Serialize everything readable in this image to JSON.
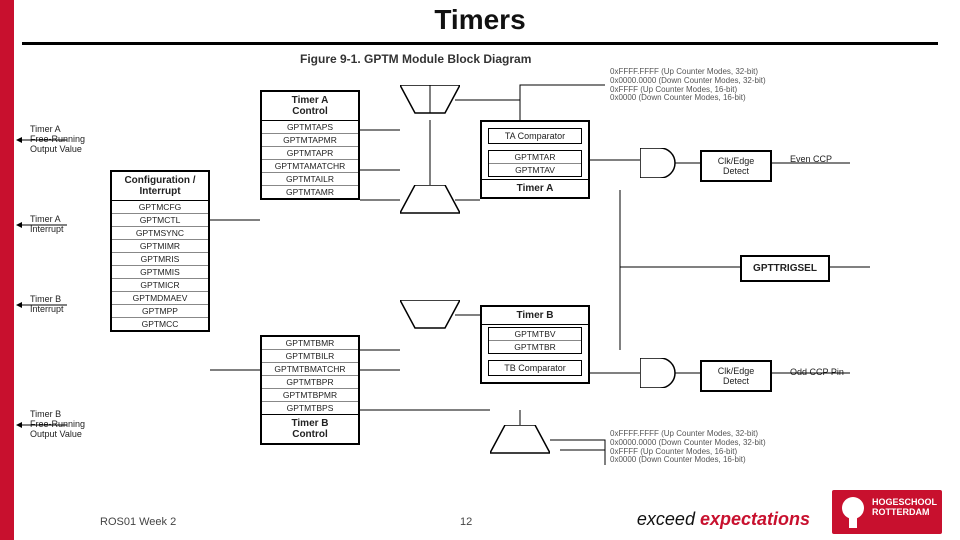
{
  "title": "Timers",
  "figure_caption": "Figure 9-1. GPTM Module Block Diagram",
  "footer": {
    "course": "ROS01 Week 2",
    "page": "12"
  },
  "tagline": {
    "a": "exceed ",
    "b": "expectations"
  },
  "logo_text": "HOGESCHOOL\nROTTERDAM",
  "labels": {
    "ta_free": "Timer A\nFree-Running\nOutput Value",
    "ta_int": "Timer A\nInterrupt",
    "tb_int": "Timer B\nInterrupt",
    "tb_free": "Timer B\nFree-Running\nOutput Value",
    "even_ccp": "Even CCP",
    "odd_ccp": "Odd CCP Pin",
    "clk_edge": "Clk/Edge\nDetect",
    "gpttrigsel": "GPTTRIGSEL",
    "modes_up32": "0xFFFF.FFFF  (Up Counter Modes, 32-bit)",
    "modes_dn32": "0x0000.0000  (Down Counter Modes, 32-bit)",
    "modes_up16": "0xFFFF        (Up Counter Modes, 16-bit)",
    "modes_dn16": "0x0000        (Down Counter Modes, 16-bit)"
  },
  "blocks": {
    "config": {
      "title": "Configuration /\nInterrupt",
      "regs": [
        "GPTMCFG",
        "GPTMCTL",
        "GPTMSYNC",
        "GPTMIMR",
        "GPTMRIS",
        "GPTMMIS",
        "GPTMICR",
        "GPTMDMAEV",
        "GPTMPP",
        "GPTMCC"
      ]
    },
    "ta_ctrl": {
      "title": "Timer A\nControl",
      "regs": [
        "GPTMTAPS",
        "GPTMTAPMR",
        "GPTMTAPR",
        "GPTMTAMATCHR",
        "GPTMTAILR",
        "GPTMTAMR"
      ]
    },
    "tb_ctrl": {
      "title": "Timer B\nControl",
      "regs": [
        "GPTMTBMR",
        "GPTMTBILR",
        "GPTMTBMATCHR",
        "GPTMTBPR",
        "GPTMTBPMR",
        "GPTMTBPS"
      ]
    },
    "ta": {
      "title": "Timer A",
      "comp": "TA Comparator",
      "regs": [
        "GPTMTAR",
        "GPTMTAV"
      ]
    },
    "tb": {
      "title": "Timer B",
      "comp": "TB Comparator",
      "regs": [
        "GPTMTBV",
        "GPTMTBR"
      ]
    }
  }
}
